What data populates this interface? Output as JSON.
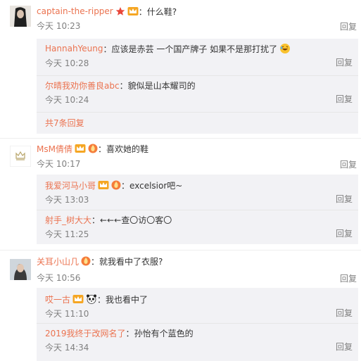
{
  "comments": [
    {
      "user": "captain-the-ripper",
      "text": "什么鞋?",
      "time": "今天 10:23",
      "reply_label": "回复",
      "replies": [
        {
          "user": "HannahYeung",
          "text": "应该是赤芸 一个国产牌子 如果不是那打扰了",
          "time": "今天 10:28",
          "reply_label": "回复"
        },
        {
          "user": "尔晴我劝你善良abc",
          "text": "貌似是山本耀司的",
          "time": "今天 10:24",
          "reply_label": "回复"
        }
      ],
      "more_replies": "共7条回复"
    },
    {
      "user": "MsM倩倩",
      "text": "喜欢她的鞋",
      "time": "今天 10:17",
      "reply_label": "回复",
      "replies": [
        {
          "user": "我爱河马小哥",
          "text": "excelsior吧~",
          "time": "今天 13:03",
          "reply_label": "回复"
        },
        {
          "user": "射手_树大大",
          "text": "←←←查〇访〇客〇",
          "time": "今天 11:25",
          "reply_label": "回复"
        }
      ]
    },
    {
      "user": "关耳小山几",
      "text": "就我看中了衣服?",
      "time": "今天 10:56",
      "reply_label": "回复",
      "replies": [
        {
          "user": "哎一古",
          "text": "我也看中了",
          "time": "今天 11:10",
          "reply_label": "回复"
        },
        {
          "user": "2019我终于改网名了",
          "text": "孙怡有个蓝色的",
          "time": "今天 14:34",
          "reply_label": "回复"
        }
      ]
    }
  ],
  "colors": {
    "username": "#eb7350",
    "text": "#333333",
    "meta": "#808080",
    "reply_bg": "#f2f2f5",
    "badge_red": "#e8463a",
    "badge_orange": "#f5a623"
  },
  "icons": {
    "vip_badge": "crown-badge-icon",
    "star_badge": "red-star-icon",
    "level_badge": "fire-level-icon",
    "emoji_laugh": "laughing-emoji-icon",
    "emoji_panda": "panda-emoji-icon"
  }
}
